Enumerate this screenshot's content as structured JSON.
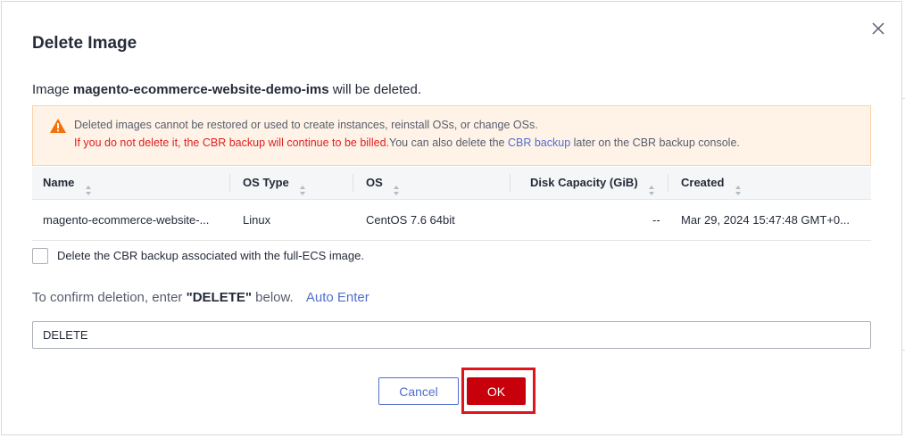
{
  "dialog": {
    "title": "Delete Image",
    "lead_prefix": "Image ",
    "image_name": "magento-ecommerce-website-demo-ims",
    "lead_suffix": " will be deleted."
  },
  "alert": {
    "line1": "Deleted images cannot be restored or used to create instances, reinstall OSs, or change OSs.",
    "line2_red": "If you do not delete it, the CBR backup will continue to be billed.",
    "line2_mid": "You can also delete the ",
    "line2_link": "CBR backup",
    "line2_end": " later on the CBR backup console.",
    "icon": "warning-icon",
    "color": "#f66f08"
  },
  "table": {
    "columns": [
      "Name",
      "OS Type",
      "OS",
      "Disk Capacity (GiB)",
      "Created"
    ],
    "rows": [
      {
        "name": "magento-ecommerce-website-...",
        "os_type": "Linux",
        "os": "CentOS 7.6 64bit",
        "disk": "--",
        "created": "Mar 29, 2024 15:47:48 GMT+0..."
      }
    ]
  },
  "checkbox": {
    "label": "Delete the CBR backup associated with the full-ECS image.",
    "checked": false
  },
  "confirm": {
    "prefix": "To confirm deletion, enter ",
    "keyword": "\"DELETE\"",
    "suffix": " below.",
    "auto_enter": "Auto Enter"
  },
  "input": {
    "value": "DELETE"
  },
  "buttons": {
    "cancel": "Cancel",
    "ok": "OK"
  },
  "colors": {
    "primary": "#c7000b",
    "link": "#526ecc",
    "highlight": "#e0141b"
  }
}
